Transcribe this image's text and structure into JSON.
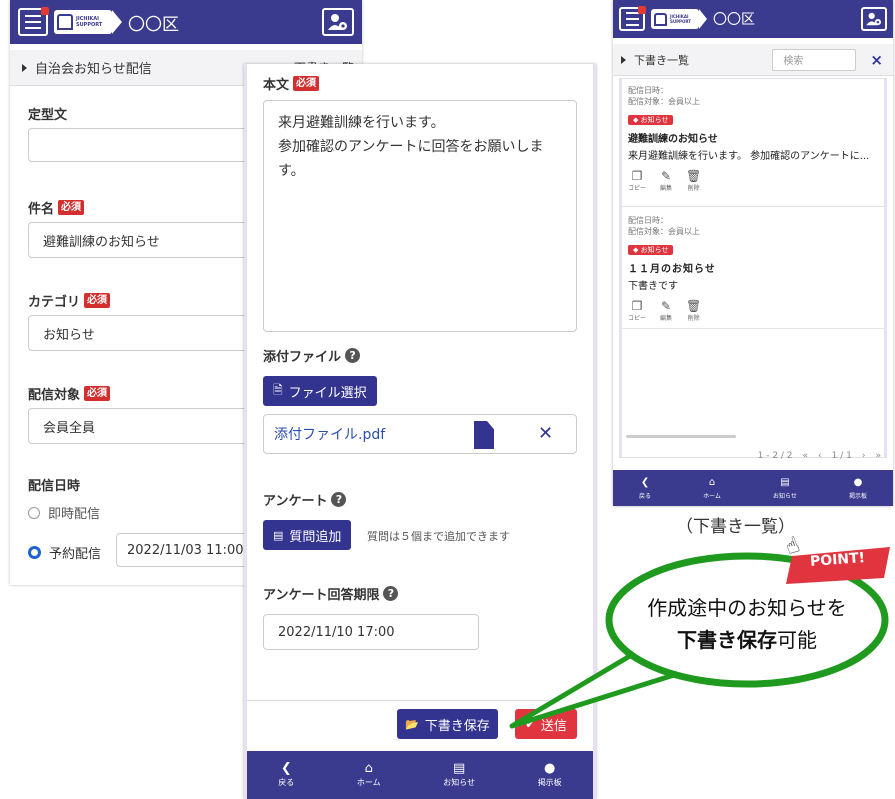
{
  "header": {
    "area_name": "〇〇区",
    "logo_text_top": "JICHIKAI",
    "logo_text_bottom": "SUPPORT"
  },
  "left_form": {
    "section_title": "自治会お知らせ配信",
    "draft_list_link": "下書き一覧",
    "template_label": "定型文",
    "subject_label": "件名",
    "subject_value": "避難訓練のお知らせ",
    "category_label": "カテゴリ",
    "category_value": "お知らせ",
    "target_label": "配信対象",
    "target_value": "会員全員",
    "datetime_label": "配信日時",
    "immediate_label": "即時配信",
    "scheduled_label": "予約配信",
    "scheduled_value": "2022/11/03 11:00"
  },
  "required_badge": "必須",
  "center_form": {
    "body_label": "本文",
    "body_text": "来月避難訓練を行います。\n参加確認のアンケートに回答をお願いします。",
    "attachment_label": "添付ファイル",
    "file_select_button": "ファイル選択",
    "attached_file_name": "添付ファイル.pdf",
    "survey_label": "アンケート",
    "add_question_button": "質問追加",
    "question_hint": "質問は５個まで追加できます",
    "deadline_label": "アンケート回答期限",
    "deadline_value": "2022/11/10 17:00",
    "save_draft_button": "下書き保存",
    "send_button": "送信"
  },
  "bottom_nav": [
    {
      "label": "戻る",
      "icon": "back-chevron-icon"
    },
    {
      "label": "ホーム",
      "icon": "home-icon"
    },
    {
      "label": "お知らせ",
      "icon": "notice-icon"
    },
    {
      "label": "掲示板",
      "icon": "board-icon"
    }
  ],
  "draft_list": {
    "section_title": "下書き一覧",
    "search_placeholder": "検索",
    "close_symbol": "×",
    "items": [
      {
        "meta_date": "配信日時：",
        "meta_target": "配信対象：会員以上",
        "category": "お知らせ",
        "title": "避難訓練のお知らせ",
        "body": "来月避難訓練を行います。 参加確認のアンケートに..."
      },
      {
        "meta_date": "配信日時：",
        "meta_target": "配信対象：会員以上",
        "category": "お知らせ",
        "title": "１１月のお知らせ",
        "body": "下書きです"
      }
    ],
    "actions": {
      "copy": "コピー",
      "edit": "編集",
      "delete": "削除"
    },
    "pager_range": "1 - 2 / 2",
    "pager_pages": "1 / 1"
  },
  "caption": "（下書き一覧）",
  "callout": {
    "point_label": "POINT!",
    "line1": "作成途中のお知らせを",
    "line2_bold": "下書き保存",
    "line2_rest": "可能"
  },
  "colors": {
    "navy": "#3a3a8f",
    "button_navy": "#333390",
    "red": "#e0343f",
    "callout_green": "#1f9a1f"
  }
}
